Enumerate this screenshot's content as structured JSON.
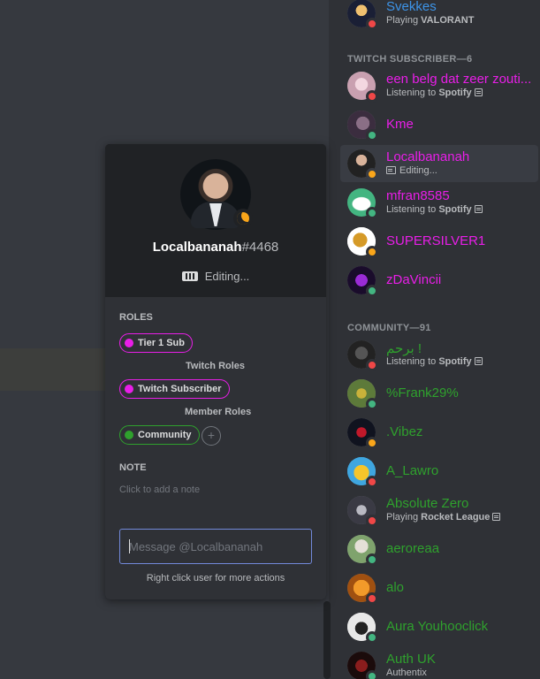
{
  "members_top": {
    "name": "Svekkes",
    "activity_prefix": "Playing ",
    "activity_game": "VALORANT"
  },
  "sections": [
    {
      "title": "TWITCH SUBSCRIBER—6"
    },
    {
      "title": "COMMUNITY—91"
    }
  ],
  "twitch_members": [
    {
      "name": "een belg dat zeer zouti...",
      "activity_prefix": "Listening to ",
      "activity_game": "Spotify"
    },
    {
      "name": "Kme"
    },
    {
      "name": "Localbananah",
      "activity_prefix": "Editing..."
    },
    {
      "name": "mfran8585",
      "activity_prefix": "Listening to ",
      "activity_game": "Spotify"
    },
    {
      "name": "SUPERSILVER1"
    },
    {
      "name": "zDaVincii"
    }
  ],
  "community_members": [
    {
      "name": "برحم !",
      "activity_prefix": "Listening to ",
      "activity_game": "Spotify"
    },
    {
      "name": "%Frank29%"
    },
    {
      "name": ".Vibez"
    },
    {
      "name": "A_Lawro"
    },
    {
      "name": "Absolute Zero",
      "activity_prefix": "Playing ",
      "activity_game": "Rocket League"
    },
    {
      "name": "aeroreaa"
    },
    {
      "name": "alo"
    },
    {
      "name": "Aura Youhooclick"
    },
    {
      "name": "Auth UK",
      "activity_prefix": "Authentix"
    }
  ],
  "popout": {
    "username": "Localbananah",
    "discriminator": "#4468",
    "activity": "Editing...",
    "roles_title": "ROLES",
    "roles": [
      {
        "label": "Tier 1 Sub",
        "color": "#e91ee8"
      },
      {
        "label": "Twitch Subscriber",
        "color": "#e91ee8"
      },
      {
        "label": "Community",
        "color": "#2fa12d"
      }
    ],
    "role_group_labels": [
      "Twitch Roles",
      "Member Roles"
    ],
    "add_role": "+",
    "note_title": "NOTE",
    "note_placeholder": "Click to add a note",
    "message_placeholder": "Message @Localbananah",
    "hint": "Right click user for more actions"
  },
  "colors": {
    "twitch_role": "#e91ee8",
    "community_role": "#2fa12d",
    "svekkes": "#3d94e8",
    "online": "#43b581",
    "idle": "#faa61a",
    "dnd": "#f04747",
    "focus": "#7289da"
  }
}
